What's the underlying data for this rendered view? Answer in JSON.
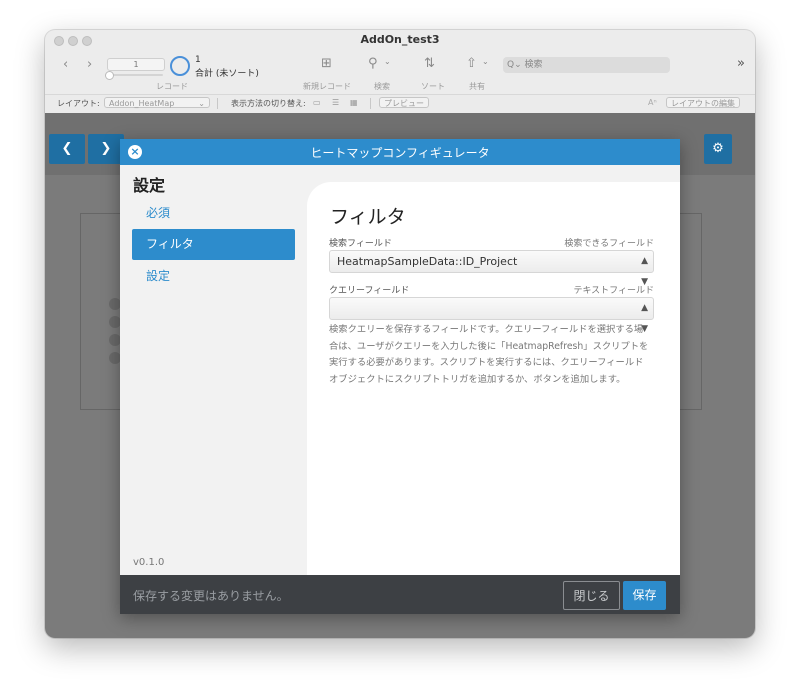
{
  "window": {
    "title": "AddOn_test3"
  },
  "toolbar": {
    "record_value": "1",
    "record_label": "レコード",
    "count": "1",
    "count_label": "合計 (未ソート)",
    "new_record_label": "新規レコード",
    "search_label": "検索",
    "sort_label": "ソート",
    "share_label": "共有",
    "search_placeholder": "検索",
    "overflow": "»"
  },
  "layoutbar": {
    "layout_label": "レイアウト:",
    "layout_value": "Addon_HeatMap",
    "view_switch_label": "表示方法の切り替え:",
    "preview_label": "プレビュー",
    "edit_layout_label": "レイアウトの編集"
  },
  "modal": {
    "title": "ヒートマップコンフィギュレータ",
    "sidebar": {
      "heading": "設定",
      "items": [
        {
          "label": "必須"
        },
        {
          "label": "フィルタ"
        },
        {
          "label": "設定"
        }
      ],
      "version": "v0.1.0"
    },
    "panel": {
      "title": "フィルタ",
      "search_field_label": "検索フィールド",
      "search_field_hint": "検索できるフィールド",
      "search_field_value": "HeatmapSampleData::ID_Project",
      "query_field_label": "クエリーフィールド",
      "query_field_hint": "テキストフィールド",
      "query_field_value": "",
      "description_lines": [
        "検索クエリーを保存するフィールドです。クエリーフィールドを選択する場",
        "合は、ユーザがクエリーを入力した後に「HeatmapRefresh」スクリプトを",
        "実行する必要があります。スクリプトを実行するには、クエリーフィールド",
        "オブジェクトにスクリプトトリガを追加するか、ボタンを追加します。"
      ]
    },
    "footer": {
      "message": "保存する変更はありません。",
      "close_label": "閉じる",
      "save_label": "保存"
    }
  },
  "colors": {
    "accent": "#2d8ccc",
    "footer": "#3d4044",
    "nav": "#1f6fa3"
  }
}
